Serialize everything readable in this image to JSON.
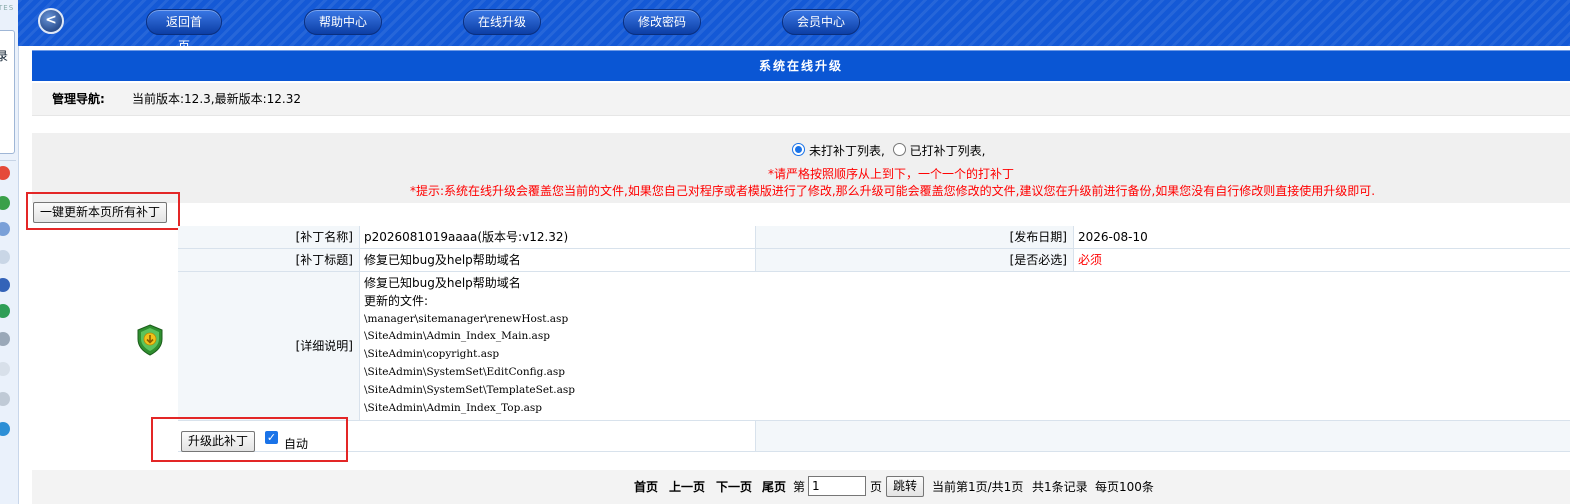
{
  "left_strip": {
    "brand_fragment": "TES",
    "panel_char": "录"
  },
  "topbar": {
    "back_symbol": "<",
    "nav": [
      "返回首页",
      "帮助中心",
      "在线升级",
      "修改密码",
      "会员中心"
    ]
  },
  "page_title": "系统在线升级",
  "nav_row": {
    "label": "管理导航:",
    "value": "当前版本:12.3,最新版本:12.32"
  },
  "filters": {
    "unpatched": "未打补丁列表,",
    "patched": "已打补丁列表,",
    "selected": "unpatched"
  },
  "warnings": {
    "order": "*请严格按照顺序从上到下，一个一个的打补丁",
    "notice": "*提示:系统在线升级会覆盖您当前的文件,如果您自己对程序或者模版进行了修改,那么升级可能会覆盖您修改的文件,建议您在升级前进行备份,如果您没有自行修改则直接使用升级即可."
  },
  "update_all_label": "一键更新本页所有补丁",
  "patch": {
    "name_label": "[补丁名称]",
    "name_value": "p2026081019aaaa(版本号:v12.32)",
    "date_label": "[发布日期]",
    "date_value": "2026-08-10",
    "title_label": "[补丁标题]",
    "title_value": "修复已知bug及help帮助域名",
    "required_label": "[是否必选]",
    "required_value": "必须",
    "detail_label": "[详细说明]",
    "detail_lines": [
      "修复已知bug及help帮助域名",
      "更新的文件:",
      "\\manager\\sitemanager\\renewHost.asp",
      "\\SiteAdmin\\Admin_Index_Main.asp",
      "\\SiteAdmin\\copyright.asp",
      "\\SiteAdmin\\SystemSet\\EditConfig.asp",
      "\\SiteAdmin\\SystemSet\\TemplateSet.asp",
      "\\SiteAdmin\\Admin_Index_Top.asp"
    ],
    "upgrade_label": "升级此补丁",
    "auto_label": "自动",
    "auto_checked": true
  },
  "pager": {
    "first": "首页",
    "prev": "上一页",
    "next": "下一页",
    "last": "尾页",
    "page_prefix": "第",
    "page_value": "1",
    "page_suffix": "页",
    "go": "跳转",
    "status": "当前第1页/共1页",
    "total": "共1条记录",
    "per_page": "每页100条"
  },
  "colors": {
    "header_blue": "#1459d6",
    "title_blue": "#0a56d4",
    "warning_red": "#ff0000",
    "highlight_red": "#e32626"
  }
}
